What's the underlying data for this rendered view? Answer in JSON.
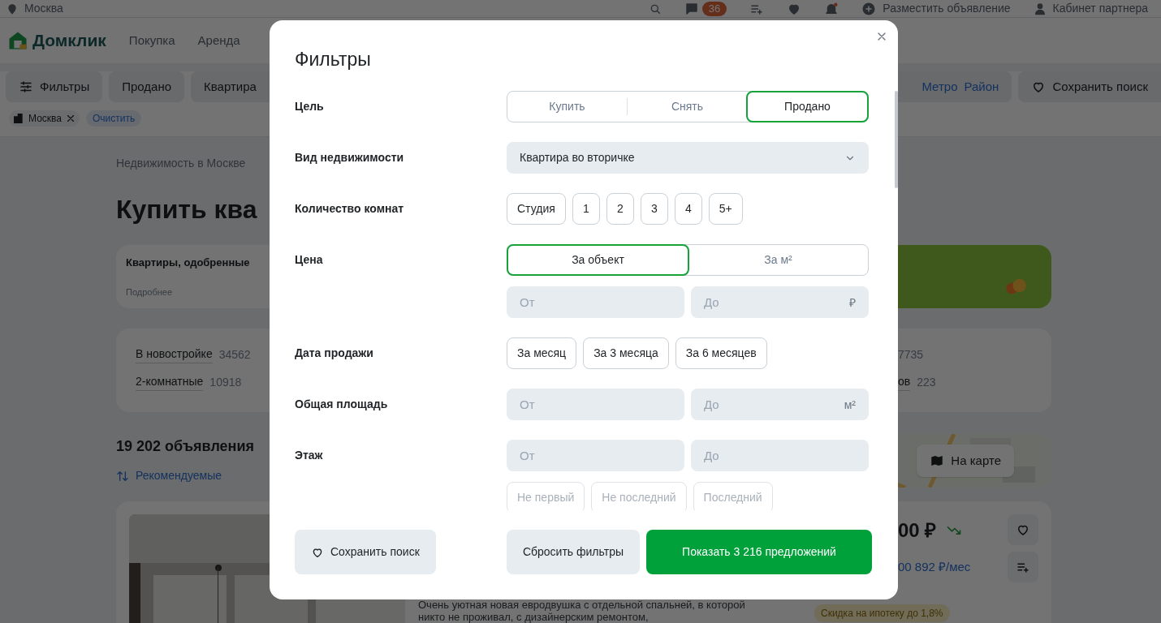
{
  "top_bar": {
    "location": "Москва",
    "messages_badge": "36",
    "post_ad": "Разместить объявление",
    "partner_cabinet": "Кабинет партнера"
  },
  "header": {
    "logo": "Домклик",
    "nav": [
      "Покупка",
      "Аренда"
    ]
  },
  "filter_bar": {
    "filters_button": "Фильтры",
    "chips": [
      "Продано",
      "Квартира"
    ],
    "metro": "Метро",
    "district": "Район",
    "save_search": "Сохранить поиск"
  },
  "applied_tags": {
    "tags": [
      "Москва"
    ],
    "clear": "Очистить"
  },
  "breadcrumb": "Недвижимость в Москве",
  "heading": "Купить ква",
  "promo": {
    "title": "Квартиры, одобренные",
    "link": "Подробнее"
  },
  "quick_links": [
    {
      "label": "В новостройке",
      "count": "34562"
    },
    {
      "label": "2-комнатные",
      "count": "10918"
    }
  ],
  "quick_links_right": [
    {
      "count": "7735"
    },
    {
      "label": "ов",
      "count": "223"
    }
  ],
  "results": {
    "count": "19 202 объявления",
    "sort": "Рекомендуемые",
    "map_button": "На карте"
  },
  "listing": {
    "price": "00 ₽",
    "monthly_payment": "00 892 ₽/мес",
    "description": "Очень уютная новая евродвушка с отдельной спальней, в которой никто не проживал, с дизайнерским ремонтом,",
    "badges": [
      {
        "kind": "discount",
        "text": "Скидка на ипотеку до 1,8%"
      }
    ]
  },
  "filters_dialog": {
    "title": "Фильтры",
    "rows": [
      {
        "label": "Цель",
        "kind": "segmented",
        "options": [
          {
            "label": "Купить",
            "selected": false
          },
          {
            "label": "Снять",
            "selected": false
          },
          {
            "label": "Продано",
            "selected": true
          }
        ]
      },
      {
        "label": "Вид недвижимости",
        "kind": "select",
        "value": "Квартира во вторичке"
      },
      {
        "label": "Количество комнат",
        "kind": "chips",
        "options": [
          {
            "label": "Студия",
            "selected": false
          },
          {
            "label": "1",
            "selected": false
          },
          {
            "label": "2",
            "selected": false
          },
          {
            "label": "3",
            "selected": false
          },
          {
            "label": "4",
            "selected": false
          },
          {
            "label": "5+",
            "selected": false
          }
        ]
      },
      {
        "label": "Цена",
        "kind": "segmented",
        "options": [
          {
            "label": "За объект",
            "selected": true
          },
          {
            "label": "За м²",
            "selected": false
          }
        ],
        "fields": [
          {
            "placeholder": "От"
          },
          {
            "placeholder": "До",
            "unit": "₽"
          }
        ]
      },
      {
        "label": "Дата продажи",
        "kind": "chips",
        "options": [
          {
            "label": "За месяц",
            "selected": false
          },
          {
            "label": "За 3 месяца",
            "selected": false
          },
          {
            "label": "За 6 месяцев",
            "selected": false
          }
        ]
      },
      {
        "label": "Общая площадь",
        "kind": "range",
        "fields": [
          {
            "placeholder": "От"
          },
          {
            "placeholder": "До",
            "unit": "м²"
          }
        ]
      },
      {
        "label": "Этаж",
        "kind": "range",
        "fields": [
          {
            "placeholder": "От"
          },
          {
            "placeholder": "До"
          }
        ],
        "options": [
          {
            "label": "Не первый",
            "selected": false
          },
          {
            "label": "Не последний",
            "selected": false
          },
          {
            "label": "Последний",
            "selected": false
          }
        ]
      }
    ],
    "buttons": {
      "save": "Сохранить поиск",
      "reset": "Сбросить фильтры",
      "show": "Показать 3 216 предложений"
    }
  }
}
